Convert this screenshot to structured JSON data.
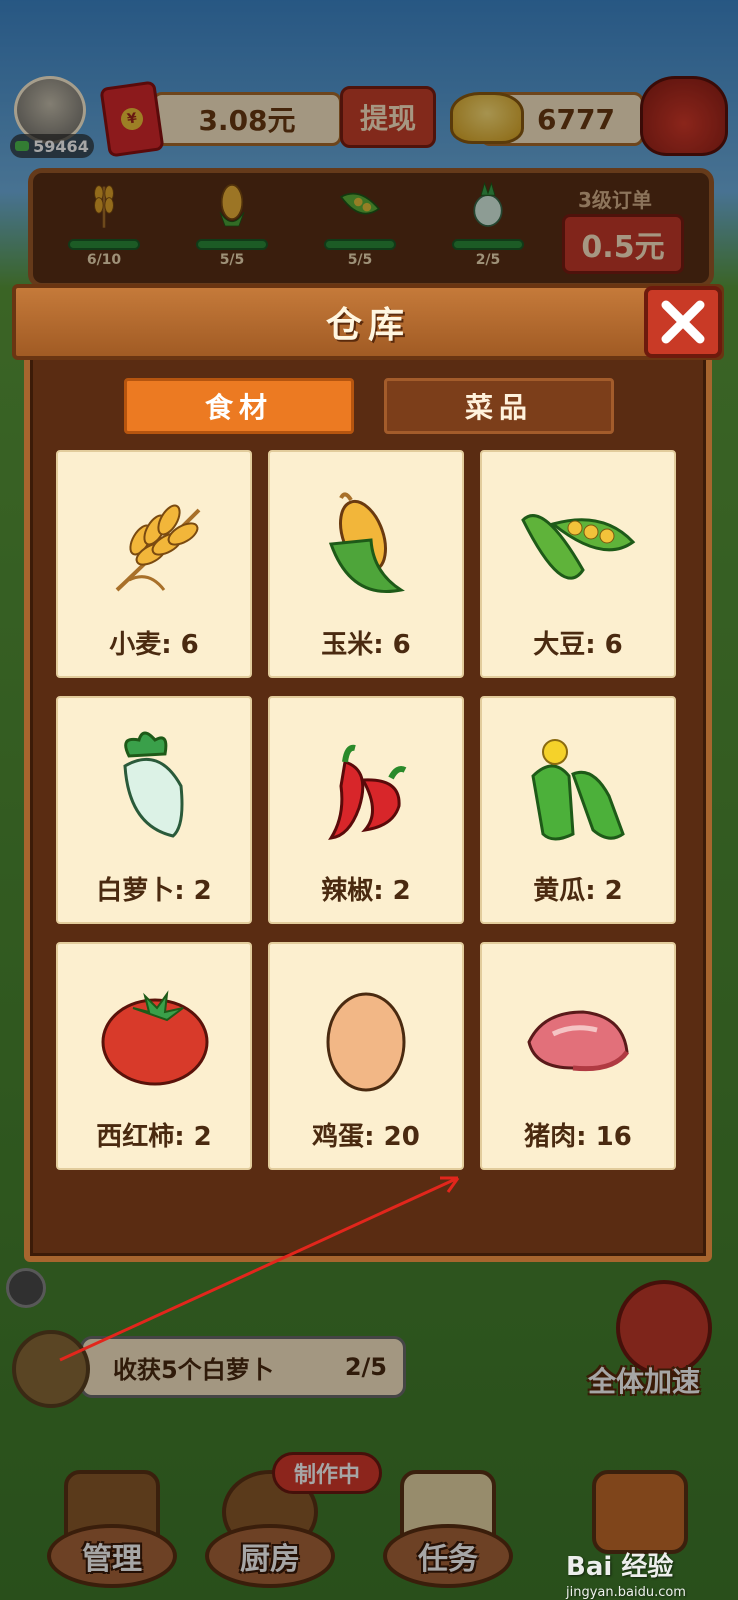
{
  "top_bar": {
    "level_value": "59464",
    "cash_amount": "3.08元",
    "withdraw_label": "提现",
    "gold_amount": "6777"
  },
  "orders": {
    "items": [
      {
        "name": "wheat",
        "count": "6/10",
        "icon": "wheat-icon"
      },
      {
        "name": "corn",
        "count": "5/5",
        "icon": "corn-icon"
      },
      {
        "name": "soybean",
        "count": "5/5",
        "icon": "soybean-icon"
      },
      {
        "name": "radish",
        "count": "2/5",
        "icon": "radish-icon"
      }
    ],
    "level_label": "3级订单",
    "price": "0.5元"
  },
  "warehouse": {
    "title": "仓库",
    "tabs": [
      {
        "label": "食材",
        "active": true
      },
      {
        "label": "菜品",
        "active": false
      }
    ],
    "items": [
      {
        "label": "小麦: 6",
        "icon": "wheat-icon"
      },
      {
        "label": "玉米: 6",
        "icon": "corn-icon"
      },
      {
        "label": "大豆: 6",
        "icon": "soybean-icon"
      },
      {
        "label": "白萝卜: 2",
        "icon": "white-radish-icon"
      },
      {
        "label": "辣椒: 2",
        "icon": "chili-icon"
      },
      {
        "label": "黄瓜: 2",
        "icon": "cucumber-icon"
      },
      {
        "label": "西红柿: 2",
        "icon": "tomato-icon"
      },
      {
        "label": "鸡蛋: 20",
        "icon": "egg-icon"
      },
      {
        "label": "猪肉: 16",
        "icon": "pork-icon"
      }
    ]
  },
  "task": {
    "text": "收获5个白萝卜",
    "progress": "2/5"
  },
  "speedup_label": "全体加速",
  "nav": [
    {
      "label": "管理",
      "icon": "hammer-icon"
    },
    {
      "label": "厨房",
      "icon": "cooking-pot-icon"
    },
    {
      "label": "任务",
      "icon": "scroll-icon"
    }
  ],
  "cooking_badge": "制作中",
  "watermark": {
    "brand": "Bai 经验",
    "url": "jingyan.baidu.com"
  },
  "colors": {
    "accent_orange": "#ec7a22",
    "wood_dark": "#5a2c12",
    "button_red": "#c93a26",
    "card_bg": "#fcefcf"
  }
}
